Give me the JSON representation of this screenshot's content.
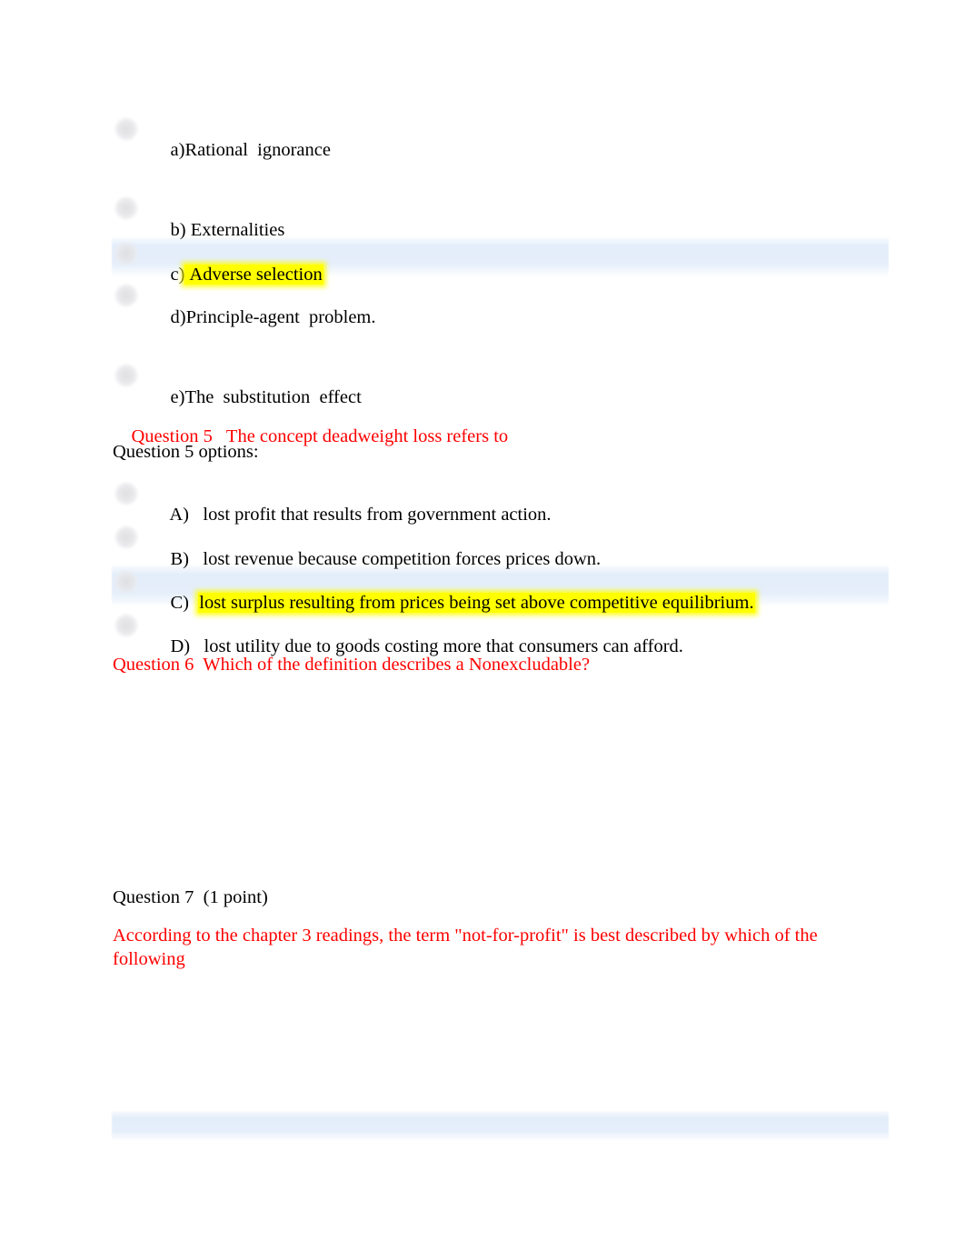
{
  "document": {
    "page_background": "#ffffff",
    "highlight_yellow": "#ffff00",
    "selection_blue": "#e8f0fa",
    "question_red": "#fe0000",
    "body_black": "#000000"
  },
  "question4_options": [
    {
      "marker": "a)",
      "text": "Rational  ignorance",
      "highlighted": false,
      "selected": false
    },
    {
      "marker": "b)",
      "text": " Externalities",
      "highlighted": false,
      "selected": false
    },
    {
      "marker": "c)",
      "text": " Adverse selection",
      "highlighted": true,
      "selected": true
    },
    {
      "marker": "d)",
      "text": "Principle-agent  problem.",
      "highlighted": false,
      "selected": false
    },
    {
      "marker": "e)",
      "text": "The  substitution  effect",
      "highlighted": false,
      "selected": false
    }
  ],
  "question5": {
    "number": "Question 5",
    "prompt": "The concept deadweight loss refers to",
    "options_label": "Question 5 options:",
    "options": [
      {
        "marker": "A)",
        "text": "lost profit that results from government action.",
        "highlighted": false,
        "selected": false
      },
      {
        "marker": "B)",
        "text": "lost revenue because competition forces prices down.",
        "highlighted": false,
        "selected": false
      },
      {
        "marker": "C)",
        "text": "lost surplus resulting from prices being set above competitive equilibrium.",
        "highlighted": true,
        "selected": true
      },
      {
        "marker": "D)",
        "text": " lost utility due to goods costing more that consumers can afford.",
        "highlighted": false,
        "selected": false
      }
    ]
  },
  "question6": {
    "text": "Question 6  Which of the definition describes a Nonexcludable?"
  },
  "question7": {
    "header": "Question 7  (1 point)",
    "prompt": "According to the chapter 3 readings, the term \"not-for-profit\" is best described by which of the following"
  }
}
